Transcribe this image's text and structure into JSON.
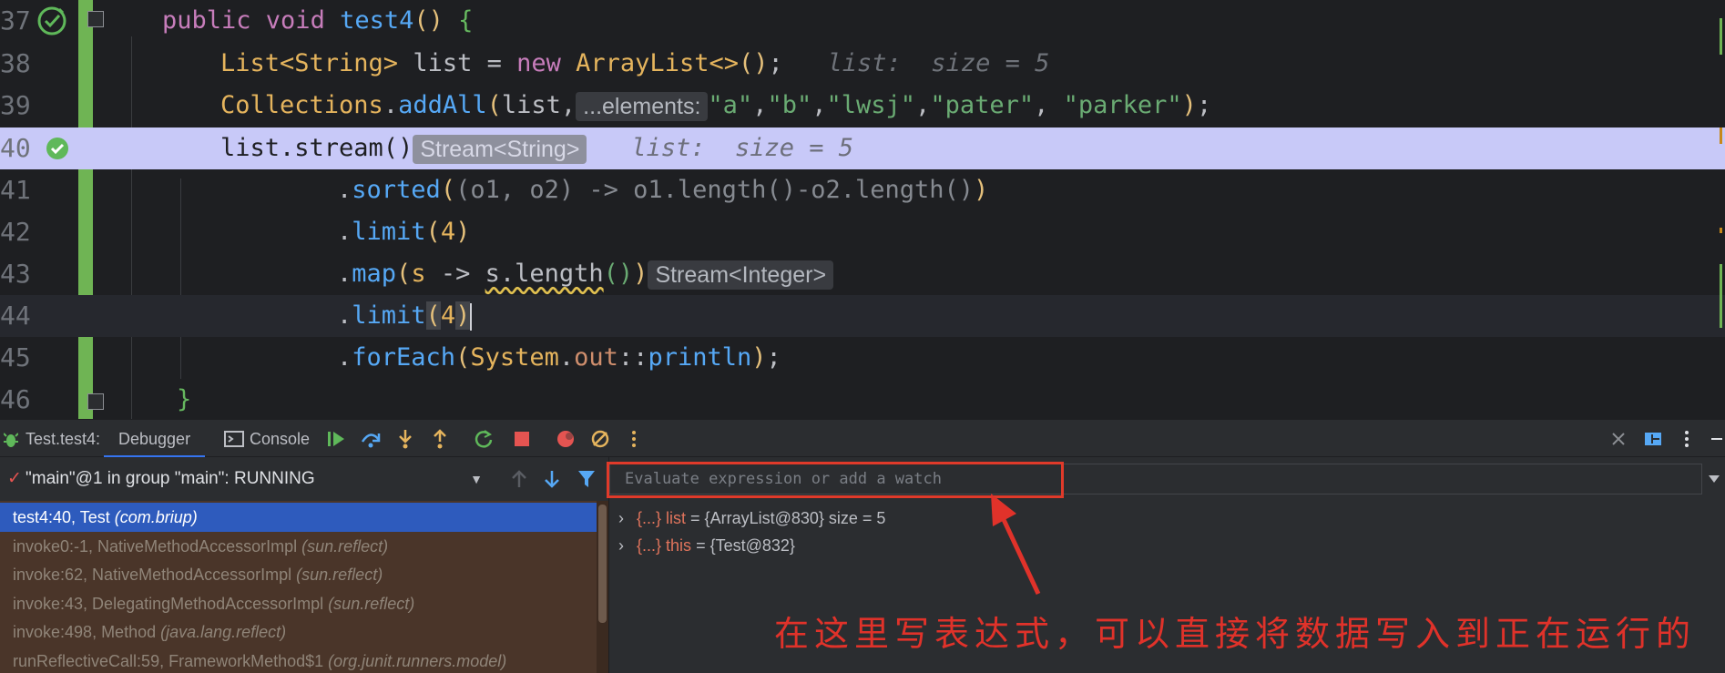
{
  "editor": {
    "lines": [
      {
        "num": "37",
        "segments": [
          {
            "t": "public ",
            "c": "kwp"
          },
          {
            "t": "void ",
            "c": "kwp"
          },
          {
            "t": "test4",
            "c": "fn"
          },
          {
            "t": "() ",
            "c": "paren"
          },
          {
            "t": "{",
            "c": "brace"
          }
        ]
      },
      {
        "num": "38",
        "segments": [
          {
            "t": "List<String> ",
            "c": "ty"
          },
          {
            "t": "list = ",
            "c": ""
          },
          {
            "t": "new ",
            "c": "kwp"
          },
          {
            "t": "ArrayList<>",
            "c": "ty"
          },
          {
            "t": "()",
            "c": "paren"
          },
          {
            "t": ";   ",
            "c": ""
          },
          {
            "t": "list:  size = 5",
            "c": "inlay-val"
          }
        ]
      },
      {
        "num": "39",
        "segments": [
          {
            "t": "Collections",
            "c": "ty"
          },
          {
            "t": ".",
            "c": ""
          },
          {
            "t": "addAll",
            "c": "fn"
          },
          {
            "t": "(",
            "c": "paren"
          },
          {
            "t": "list,",
            "c": ""
          },
          {
            "hint": "...elements:"
          },
          {
            "t": "\"a\"",
            "c": "str"
          },
          {
            "t": ",",
            "c": ""
          },
          {
            "t": "\"b\"",
            "c": "str"
          },
          {
            "t": ",",
            "c": ""
          },
          {
            "t": "\"lwsj\"",
            "c": "str"
          },
          {
            "t": ",",
            "c": ""
          },
          {
            "t": "\"pater\"",
            "c": "str"
          },
          {
            "t": ", ",
            "c": ""
          },
          {
            "t": "\"parker\"",
            "c": "str"
          },
          {
            "t": ")",
            "c": "paren"
          },
          {
            "t": ";",
            "c": ""
          }
        ]
      },
      {
        "num": "40",
        "segments": [
          {
            "t": "list.stream()",
            "c": ""
          },
          {
            "hint": "Stream<String>"
          },
          {
            "t": "   ",
            "c": ""
          },
          {
            "t": "list:  size = 5",
            "c": "inlay-val"
          }
        ]
      },
      {
        "num": "41",
        "segments": [
          {
            "t": ".",
            "c": ""
          },
          {
            "t": "sorted",
            "c": "fn"
          },
          {
            "t": "(",
            "c": "paren"
          },
          {
            "t": "(o1, o2) -> o1.length()-o2.length()",
            "c": "grey"
          },
          {
            "t": ")",
            "c": "paren"
          }
        ]
      },
      {
        "num": "42",
        "segments": [
          {
            "t": ".",
            "c": ""
          },
          {
            "t": "limit",
            "c": "fn"
          },
          {
            "t": "(",
            "c": "paren"
          },
          {
            "t": "4",
            "c": "ty"
          },
          {
            "t": ")",
            "c": "paren"
          }
        ]
      },
      {
        "num": "43",
        "segments": [
          {
            "t": ".",
            "c": ""
          },
          {
            "t": "map",
            "c": "fn"
          },
          {
            "t": "(",
            "c": "paren"
          },
          {
            "t": "s ",
            "c": "ty"
          },
          {
            "t": "-> ",
            "c": ""
          },
          {
            "t": "s.length",
            "c": "squig"
          },
          {
            "t": "()",
            "c": "str"
          },
          {
            "t": ")",
            "c": "paren"
          },
          {
            "hint": "Stream<Integer>"
          }
        ]
      },
      {
        "num": "44",
        "segments": [
          {
            "t": ".",
            "c": ""
          },
          {
            "t": "limit",
            "c": "fn"
          },
          {
            "t": "(",
            "c": "hl-paren paren"
          },
          {
            "t": "4",
            "c": "ty"
          },
          {
            "t": ")",
            "c": "hl-paren paren"
          },
          {
            "caret": true
          }
        ]
      },
      {
        "num": "45",
        "segments": [
          {
            "t": ".",
            "c": ""
          },
          {
            "t": "forEach",
            "c": "fn"
          },
          {
            "t": "(",
            "c": "paren"
          },
          {
            "t": "System",
            "c": "ty"
          },
          {
            "t": ".",
            "c": ""
          },
          {
            "t": "out",
            "c": "kw"
          },
          {
            "t": "::",
            "c": ""
          },
          {
            "t": "println",
            "c": "fn"
          },
          {
            "t": ")",
            "c": "paren"
          },
          {
            "t": ";",
            "c": ""
          }
        ]
      },
      {
        "num": "46",
        "segments": [
          {
            "t": "}",
            "c": "brace"
          }
        ]
      }
    ]
  },
  "toolbar": {
    "session": "Test.test4:",
    "tab_debugger": "Debugger",
    "tab_console": "Console"
  },
  "thread": {
    "label": "\"main\"@1 in group \"main\": RUNNING"
  },
  "frames": [
    {
      "method": "test4:40, Test ",
      "pkg": "(com.briup)",
      "selected": true
    },
    {
      "method": "invoke0:-1, NativeMethodAccessorImpl ",
      "pkg": "(sun.reflect)",
      "selected": false
    },
    {
      "method": "invoke:62, NativeMethodAccessorImpl ",
      "pkg": "(sun.reflect)",
      "selected": false
    },
    {
      "method": "invoke:43, DelegatingMethodAccessorImpl ",
      "pkg": "(sun.reflect)",
      "selected": false
    },
    {
      "method": "invoke:498, Method ",
      "pkg": "(java.lang.reflect)",
      "selected": false
    },
    {
      "method": "runReflectiveCall:59, FrameworkMethod$1 ",
      "pkg": "(org.junit.runners.model)",
      "selected": false
    }
  ],
  "watch": {
    "placeholder": "Evaluate expression or add a watch"
  },
  "variables": [
    {
      "badge": "{...}",
      "name": "list",
      "value": " = {ArrayList@830}  size = 5"
    },
    {
      "badge": "{...}",
      "name": "this",
      "value": " = {Test@832}"
    }
  ],
  "annotation": "在这里写表达式，可以直接将数据写入到正在运行的",
  "colors": {
    "accent": "#3574f0",
    "annotation_red": "#e03a2a",
    "exec_line": "#c8c9f8",
    "change_bar": "#6fb454"
  }
}
